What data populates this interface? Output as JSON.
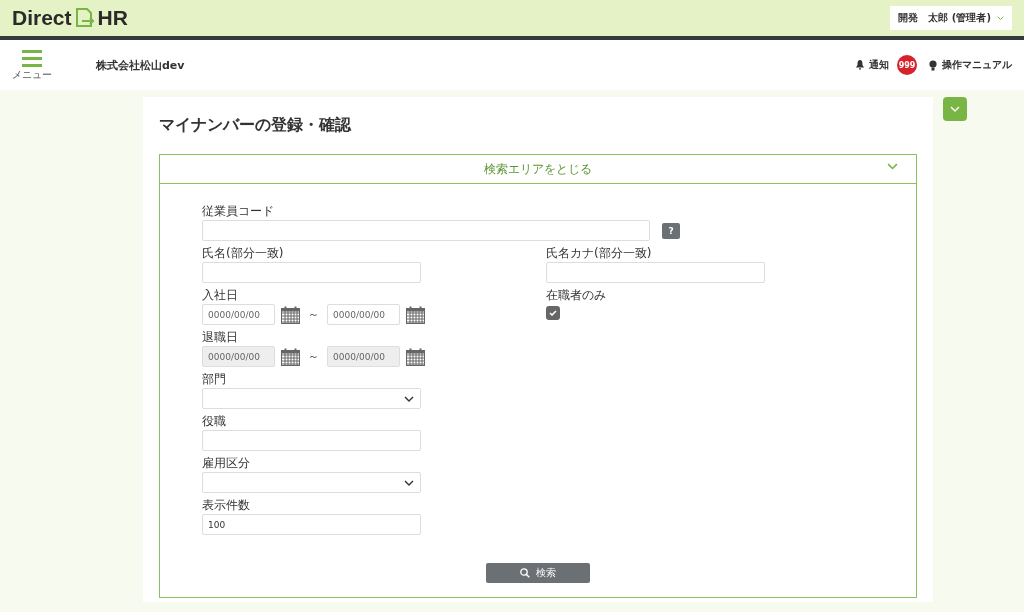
{
  "header": {
    "logo_left": "Direct",
    "logo_right": "HR",
    "user_menu": "開発　太郎 (管理者)"
  },
  "subheader": {
    "menu_label": "メニュー",
    "company": "株式会社松山dev",
    "notice": "通知",
    "notice_count": "999",
    "manual": "操作マニュアル"
  },
  "page": {
    "title": "マイナンバーの登録・確認",
    "collapse_label": "検索エリアをとじる",
    "expanded": true
  },
  "rows": [
    {
      "fields": [
        {
          "kind": "text",
          "label": "従業員コード",
          "help": "?"
        }
      ]
    },
    {
      "fields": [
        {
          "kind": "text",
          "label": "氏名(部分一致)"
        },
        {
          "kind": "text",
          "label": "氏名カナ(部分一致)"
        }
      ]
    },
    {
      "fields": [
        {
          "kind": "date_range",
          "label": "入社日",
          "from_placeholder": "0000/00/00",
          "separator": "～",
          "to_placeholder": "0000/00/00",
          "disabled": false
        },
        {
          "kind": "checkbox",
          "label": "在職者のみ",
          "checked": true
        }
      ]
    },
    {
      "fields": [
        {
          "kind": "date_range",
          "label": "退職日",
          "from_placeholder": "0000/00/00",
          "separator": "～",
          "to_placeholder": "0000/00/00",
          "disabled": true
        }
      ]
    },
    {
      "fields": [
        {
          "kind": "select",
          "label": "部門"
        }
      ]
    },
    {
      "fields": [
        {
          "kind": "text",
          "label": "役職"
        }
      ]
    },
    {
      "fields": [
        {
          "kind": "select",
          "label": "雇用区分"
        }
      ]
    },
    {
      "fields": [
        {
          "kind": "text",
          "label": "表示件数",
          "value": "100"
        }
      ]
    }
  ],
  "search_button": "検索"
}
